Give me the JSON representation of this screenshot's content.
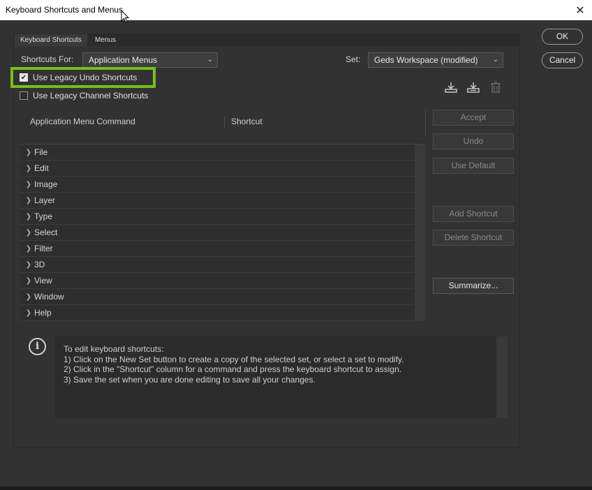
{
  "window": {
    "title": "Keyboard Shortcuts and Menus"
  },
  "tabs": [
    {
      "label": "Keyboard Shortcuts",
      "active": true
    },
    {
      "label": "Menus",
      "active": false
    }
  ],
  "shortcuts_for": {
    "label": "Shortcuts For:",
    "value": "Application Menus"
  },
  "set": {
    "label": "Set:",
    "value": "Geds Workspace (modified)"
  },
  "options": [
    {
      "label": "Use Legacy Undo Shortcuts",
      "checked": true,
      "highlighted": true
    },
    {
      "label": "Use Legacy Channel Shortcuts",
      "checked": false
    }
  ],
  "set_icons": [
    "save-set-icon",
    "new-set-icon",
    "delete-set-icon"
  ],
  "table": {
    "columns": [
      "Application Menu Command",
      "Shortcut"
    ],
    "rows": [
      "File",
      "Edit",
      "Image",
      "Layer",
      "Type",
      "Select",
      "Filter",
      "3D",
      "View",
      "Window",
      "Help"
    ]
  },
  "side_buttons": {
    "accept": "Accept",
    "undo": "Undo",
    "use_default": "Use Default",
    "add_shortcut": "Add Shortcut",
    "delete_shortcut": "Delete Shortcut",
    "summarize": "Summarize..."
  },
  "dialog_buttons": {
    "ok": "OK",
    "cancel": "Cancel"
  },
  "info": {
    "lines": [
      "To edit keyboard shortcuts:",
      "1) Click on the New Set button to create a copy of the selected set, or select a set to modify.",
      "2) Click in the \"Shortcut\" column for a command and press the keyboard shortcut to assign.",
      "3) Save the set when you are done editing to save all your changes."
    ]
  },
  "colors": {
    "highlight": "#74c01e",
    "background": "#323232",
    "titlebar": "#ffffff"
  }
}
